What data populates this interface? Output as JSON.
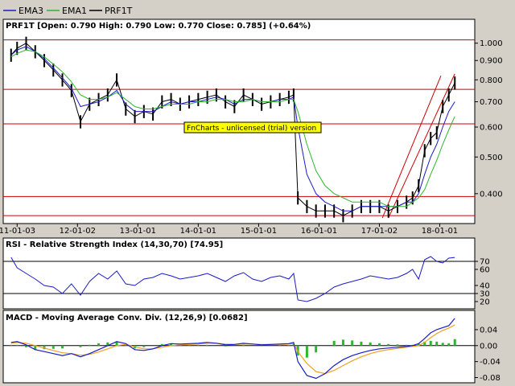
{
  "legend": [
    {
      "name": "EMA3",
      "color": "#1b1bc8"
    },
    {
      "name": "EMA1",
      "color": "#2fb52f"
    },
    {
      "name": "PRF1T",
      "color": "#000000"
    }
  ],
  "colors": {
    "price": "#000000",
    "ema_slow": "#1b1bc8",
    "ema_fast": "#2fb52f",
    "hline": "#cc0000",
    "rsi_line": "#1b1bc8",
    "macd_line": "#1b1bc8",
    "signal_line": "#f0a020",
    "hist": "#2fb52f",
    "sell_marker": "#e00000",
    "buy_marker": "#00b000",
    "watermark_bg": "#ffff00"
  },
  "watermark": "FnCharts - unlicensed (trial) version",
  "chart_data": [
    {
      "type": "line",
      "panel": "price",
      "title": "PRF1T [Open: 0.790  High: 0.790  Low: 0.770  Close: 0.785] (+0.64%)",
      "xlabel": "",
      "ylabel": "",
      "scale": "log",
      "ylim": [
        0.34,
        1.08
      ],
      "yticks": [
        1.0,
        0.9,
        0.8,
        0.7,
        0.6,
        0.5,
        0.4
      ],
      "ytick_labels": [
        "1.000",
        "0.900",
        "0.800",
        "0.700",
        "0.600",
        "0.500",
        "0.400"
      ],
      "xtick_labels": [
        "11-01-03",
        "12-01-02",
        "13-01-01",
        "14-01-01",
        "15-01-01",
        "16-01-01",
        "17-01-02",
        "18-01-01"
      ],
      "xlim": [
        2010.85,
        2018.5
      ],
      "xtick_positions": [
        2011.0,
        2012.0,
        2013.0,
        2014.0,
        2015.0,
        2016.0,
        2017.0,
        2018.0
      ],
      "horizontal_lines": [
        1.02,
        0.755,
        0.612,
        0.393,
        0.35
      ],
      "trend_lines": [
        {
          "x": [
            2017.05,
            2018.02
          ],
          "y": [
            0.345,
            0.82
          ]
        },
        {
          "x": [
            2017.15,
            2018.25
          ],
          "y": [
            0.345,
            0.83
          ]
        }
      ],
      "x": [
        2010.9,
        2011.0,
        2011.15,
        2011.3,
        2011.45,
        2011.6,
        2011.75,
        2011.9,
        2012.05,
        2012.2,
        2012.35,
        2012.5,
        2012.65,
        2012.8,
        2012.95,
        2013.1,
        2013.25,
        2013.4,
        2013.55,
        2013.7,
        2013.85,
        2014.0,
        2014.15,
        2014.3,
        2014.45,
        2014.6,
        2014.75,
        2014.9,
        2015.05,
        2015.2,
        2015.35,
        2015.5,
        2015.58,
        2015.65,
        2015.8,
        2015.95,
        2016.1,
        2016.25,
        2016.4,
        2016.55,
        2016.7,
        2016.85,
        2017.0,
        2017.15,
        2017.3,
        2017.45,
        2017.55,
        2017.65,
        2017.75,
        2017.85,
        2017.95,
        2018.05,
        2018.15,
        2018.25
      ],
      "series": [
        {
          "name": "PRF1T",
          "values": [
            0.93,
            0.97,
            1.0,
            0.95,
            0.9,
            0.85,
            0.8,
            0.75,
            0.62,
            0.69,
            0.71,
            0.73,
            0.8,
            0.67,
            0.64,
            0.66,
            0.65,
            0.7,
            0.71,
            0.69,
            0.7,
            0.71,
            0.72,
            0.73,
            0.7,
            0.68,
            0.73,
            0.71,
            0.69,
            0.7,
            0.71,
            0.72,
            0.73,
            0.39,
            0.37,
            0.36,
            0.36,
            0.36,
            0.35,
            0.36,
            0.37,
            0.37,
            0.37,
            0.36,
            0.37,
            0.38,
            0.39,
            0.42,
            0.52,
            0.56,
            0.58,
            0.68,
            0.73,
            0.785
          ]
        },
        {
          "name": "EMA3",
          "values": [
            0.93,
            0.96,
            0.98,
            0.95,
            0.91,
            0.86,
            0.81,
            0.76,
            0.68,
            0.69,
            0.7,
            0.72,
            0.75,
            0.69,
            0.66,
            0.66,
            0.66,
            0.68,
            0.7,
            0.69,
            0.7,
            0.7,
            0.71,
            0.72,
            0.71,
            0.69,
            0.71,
            0.71,
            0.7,
            0.7,
            0.71,
            0.71,
            0.72,
            0.6,
            0.45,
            0.4,
            0.38,
            0.37,
            0.36,
            0.36,
            0.37,
            0.37,
            0.37,
            0.37,
            0.37,
            0.38,
            0.38,
            0.4,
            0.45,
            0.5,
            0.54,
            0.6,
            0.66,
            0.7
          ]
        },
        {
          "name": "EMA1",
          "values": [
            0.92,
            0.94,
            0.96,
            0.95,
            0.92,
            0.88,
            0.84,
            0.79,
            0.73,
            0.71,
            0.71,
            0.72,
            0.74,
            0.71,
            0.68,
            0.67,
            0.67,
            0.68,
            0.69,
            0.69,
            0.69,
            0.7,
            0.7,
            0.71,
            0.71,
            0.7,
            0.7,
            0.71,
            0.7,
            0.7,
            0.7,
            0.71,
            0.71,
            0.66,
            0.54,
            0.46,
            0.42,
            0.4,
            0.39,
            0.38,
            0.38,
            0.38,
            0.38,
            0.37,
            0.37,
            0.37,
            0.38,
            0.39,
            0.41,
            0.45,
            0.49,
            0.54,
            0.59,
            0.64
          ]
        }
      ]
    },
    {
      "type": "line",
      "panel": "rsi",
      "title": "RSI - Relative Strength Index (14,30,70) [74.95]",
      "ylim": [
        15,
        85
      ],
      "yticks": [
        70,
        60,
        40,
        30,
        20
      ],
      "ytick_labels": [
        "70",
        "60",
        "40",
        "30",
        "20"
      ],
      "horizontal_lines": [
        70,
        30
      ],
      "x": [
        2010.9,
        2011.0,
        2011.15,
        2011.3,
        2011.45,
        2011.6,
        2011.75,
        2011.9,
        2012.05,
        2012.2,
        2012.35,
        2012.5,
        2012.65,
        2012.8,
        2012.95,
        2013.1,
        2013.25,
        2013.4,
        2013.55,
        2013.7,
        2013.85,
        2014.0,
        2014.15,
        2014.3,
        2014.45,
        2014.6,
        2014.75,
        2014.9,
        2015.05,
        2015.2,
        2015.35,
        2015.5,
        2015.58,
        2015.65,
        2015.8,
        2015.95,
        2016.1,
        2016.25,
        2016.4,
        2016.55,
        2016.7,
        2016.85,
        2017.0,
        2017.15,
        2017.3,
        2017.45,
        2017.55,
        2017.65,
        2017.75,
        2017.85,
        2017.95,
        2018.05,
        2018.15,
        2018.25
      ],
      "series": [
        {
          "name": "RSI",
          "values": [
            75,
            62,
            55,
            48,
            40,
            38,
            30,
            42,
            28,
            45,
            55,
            48,
            58,
            42,
            40,
            48,
            50,
            55,
            52,
            48,
            50,
            52,
            55,
            50,
            45,
            52,
            56,
            48,
            45,
            50,
            52,
            48,
            55,
            22,
            20,
            24,
            30,
            38,
            42,
            45,
            48,
            52,
            50,
            48,
            50,
            55,
            60,
            48,
            72,
            76,
            70,
            68,
            74,
            74.95
          ]
        }
      ]
    },
    {
      "type": "line",
      "panel": "macd",
      "title": "MACD - Moving Average Conv. Div. (12,26,9) [0.0682]",
      "ylim": [
        -0.085,
        0.06
      ],
      "yticks": [
        0.04,
        0.0,
        -0.04,
        -0.08
      ],
      "ytick_labels": [
        "0.04",
        "0.00",
        "-0.04",
        "-0.08"
      ],
      "horizontal_lines": [
        0.0
      ],
      "x": [
        2010.9,
        2011.0,
        2011.15,
        2011.3,
        2011.45,
        2011.6,
        2011.75,
        2011.9,
        2012.05,
        2012.2,
        2012.35,
        2012.5,
        2012.65,
        2012.8,
        2012.95,
        2013.1,
        2013.25,
        2013.4,
        2013.55,
        2013.7,
        2013.85,
        2014.0,
        2014.15,
        2014.3,
        2014.45,
        2014.6,
        2014.75,
        2014.9,
        2015.05,
        2015.2,
        2015.35,
        2015.5,
        2015.58,
        2015.65,
        2015.8,
        2015.95,
        2016.1,
        2016.25,
        2016.4,
        2016.55,
        2016.7,
        2016.85,
        2017.0,
        2017.15,
        2017.3,
        2017.45,
        2017.55,
        2017.65,
        2017.75,
        2017.85,
        2017.95,
        2018.05,
        2018.15,
        2018.25
      ],
      "series": [
        {
          "name": "MACD",
          "values": [
            0.008,
            0.01,
            0.002,
            -0.01,
            -0.015,
            -0.02,
            -0.025,
            -0.02,
            -0.028,
            -0.02,
            -0.01,
            0.0,
            0.01,
            0.005,
            -0.01,
            -0.012,
            -0.008,
            0.0,
            0.005,
            0.004,
            0.005,
            0.006,
            0.008,
            0.006,
            0.002,
            0.003,
            0.006,
            0.004,
            0.002,
            0.003,
            0.004,
            0.005,
            0.008,
            -0.04,
            -0.075,
            -0.082,
            -0.07,
            -0.05,
            -0.035,
            -0.025,
            -0.018,
            -0.012,
            -0.008,
            -0.006,
            -0.004,
            -0.002,
            0.0,
            0.005,
            0.018,
            0.032,
            0.04,
            0.045,
            0.05,
            0.0682
          ]
        },
        {
          "name": "Signal",
          "values": [
            0.006,
            0.008,
            0.006,
            0.0,
            -0.006,
            -0.012,
            -0.018,
            -0.02,
            -0.024,
            -0.022,
            -0.016,
            -0.008,
            0.0,
            0.003,
            -0.003,
            -0.008,
            -0.008,
            -0.004,
            0.0,
            0.002,
            0.003,
            0.004,
            0.006,
            0.006,
            0.004,
            0.003,
            0.004,
            0.004,
            0.003,
            0.003,
            0.003,
            0.004,
            0.005,
            -0.015,
            -0.045,
            -0.065,
            -0.07,
            -0.062,
            -0.05,
            -0.038,
            -0.028,
            -0.02,
            -0.014,
            -0.01,
            -0.007,
            -0.004,
            -0.002,
            0.0,
            0.008,
            0.02,
            0.03,
            0.038,
            0.044,
            0.052
          ]
        }
      ]
    }
  ]
}
